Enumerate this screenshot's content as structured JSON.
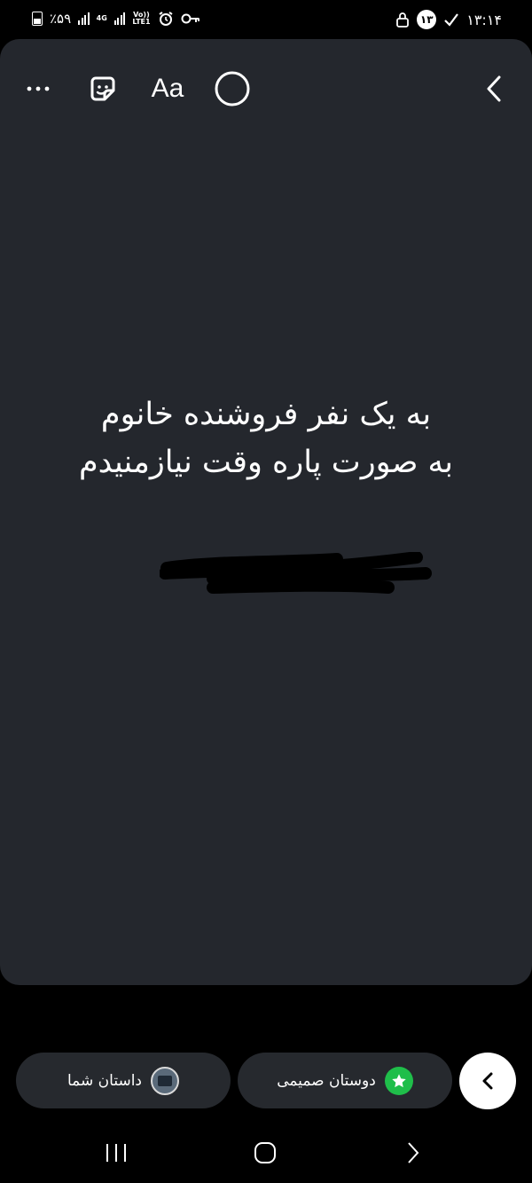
{
  "status_bar": {
    "battery": "٪۵۹",
    "network_type": "4G",
    "volte": "Vo))",
    "lte": "LTE1",
    "time": "۱۳:۱۴",
    "notification_count": "۱۳",
    "icons": [
      "battery-icon",
      "signal-icon",
      "signal-icon",
      "alarm-icon",
      "key-icon",
      "lock-icon",
      "check-icon"
    ]
  },
  "toolbar": {
    "text_tool_label": "Aa",
    "icons": [
      "more-icon",
      "sticker-icon",
      "draw-circle-icon",
      "back-chevron-icon"
    ]
  },
  "story": {
    "line1": "به یک نفر فروشنده خانوم",
    "line2": "به صورت پاره وقت نیازمنیدم",
    "background": "#24272d"
  },
  "share": {
    "your_story_label": "داستان شما",
    "close_friends_label": "دوستان صمیمی",
    "accent": "#1fbe4a"
  },
  "nav": {
    "icons": [
      "recents-icon",
      "home-icon",
      "back-icon"
    ]
  }
}
